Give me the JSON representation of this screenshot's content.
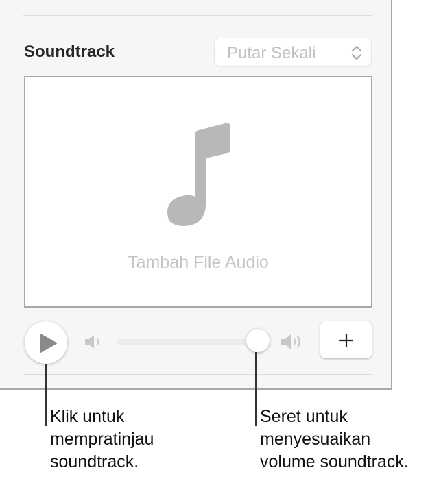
{
  "soundtrack_panel": {
    "title": "Soundtrack",
    "playback_mode": {
      "selected": "Putar Sekali"
    },
    "audio_well": {
      "placeholder": "Tambah File Audio",
      "icon": "music-note-icon"
    },
    "controls": {
      "play_icon": "play-icon",
      "volume_low_icon": "speaker-low-icon",
      "volume_high_icon": "speaker-high-icon",
      "volume_level": 0.92,
      "add_button_label": "+"
    }
  },
  "callouts": {
    "play": [
      "Klik untuk",
      "mempratinjau",
      "soundtrack."
    ],
    "volume": [
      "Seret untuk",
      "menyesuaikan",
      "volume soundtrack."
    ]
  },
  "colors": {
    "panel_background": "#f6f6f6",
    "panel_border": "#a9a9a9",
    "note_icon": "#b8b8b8",
    "placeholder_text": "#c4c4c4"
  }
}
